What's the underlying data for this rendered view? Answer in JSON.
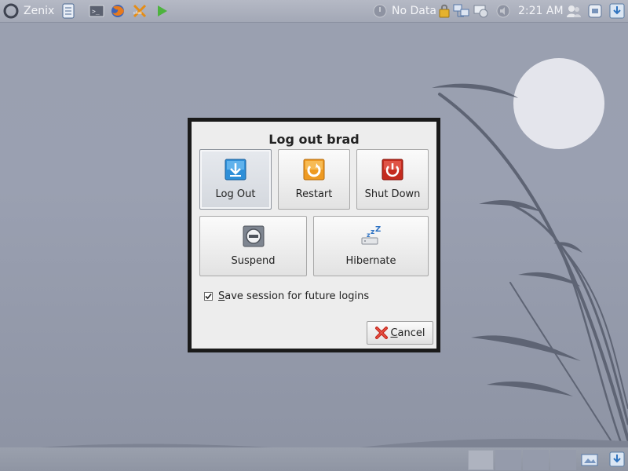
{
  "top_panel": {
    "menu_label": "Zenix",
    "network_status": "No Data",
    "clock": "2:21 AM",
    "launchers": [
      "file-manager-icon",
      "terminal-icon",
      "firefox-icon",
      "chat-icon",
      "tools-icon",
      "play-icon"
    ],
    "tray": [
      "network-icon",
      "lock-icon",
      "network-manager-icon",
      "system-updates-icon",
      "volume-icon",
      "users-icon",
      "screenshot-icon",
      "download-icon"
    ]
  },
  "dialog": {
    "title": "Log out brad",
    "buttons": [
      {
        "label": "Log Out",
        "icon": "log-out-icon"
      },
      {
        "label": "Restart",
        "icon": "restart-icon"
      },
      {
        "label": "Shut Down",
        "icon": "power-icon"
      },
      {
        "label": "Suspend",
        "icon": "suspend-icon"
      },
      {
        "label": "Hibernate",
        "icon": "hibernate-icon"
      }
    ],
    "save_session": {
      "label_access": "S",
      "label_rest": "ave session for future logins",
      "checked": true
    },
    "cancel": {
      "label_access": "C",
      "label_rest": "ancel"
    }
  },
  "colors": {
    "wallpaper": "#9aa0b0",
    "moon": "#e4e5ec",
    "grass": "#5a6070",
    "dialog_border": "#1a1a1a",
    "dialog_bg": "#ededed"
  }
}
